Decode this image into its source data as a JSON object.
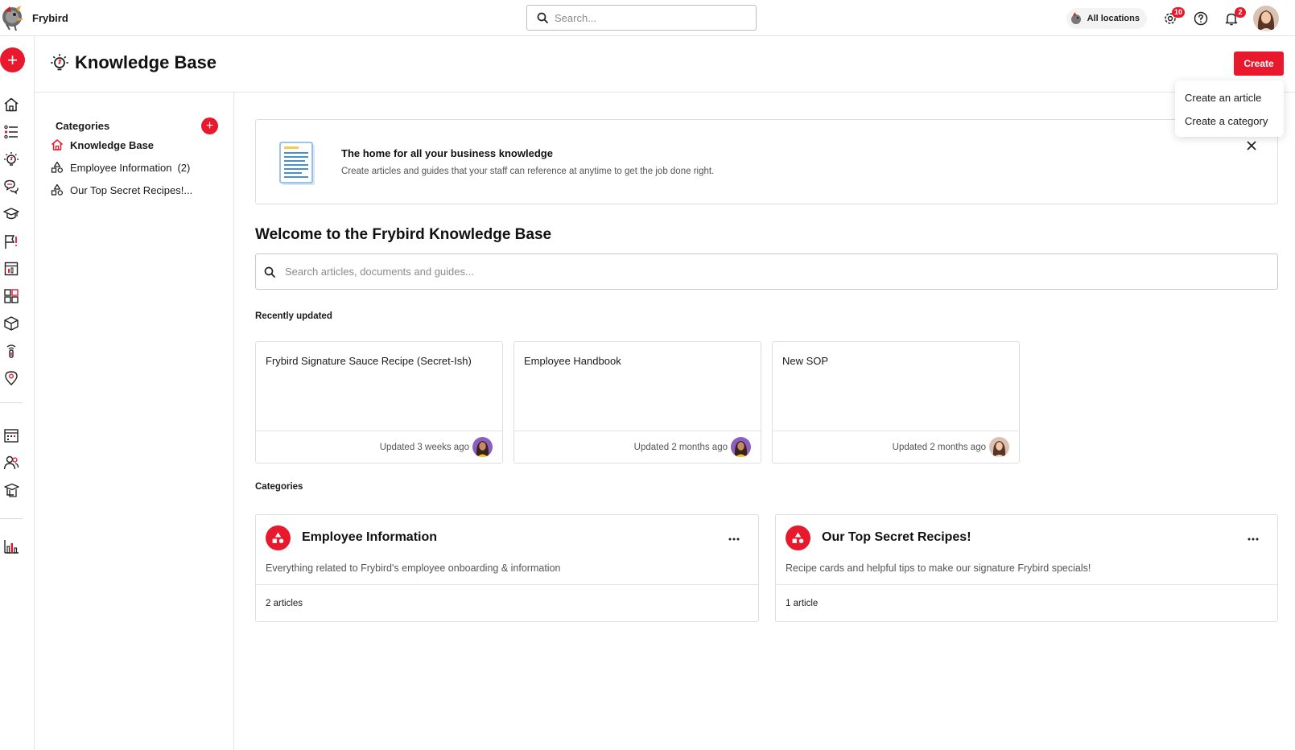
{
  "app": {
    "name": "Frybird",
    "search_placeholder": "Search...",
    "location_label": "All locations",
    "tasks_badge": "10",
    "notifications_badge": "2"
  },
  "rail": {
    "icons": [
      "home-icon",
      "checklist-icon",
      "lightbulb-icon",
      "chat-icon",
      "graduation-cap-icon",
      "flag-icon",
      "store-icon",
      "dashboard-icon",
      "box-icon",
      "thermometer-icon",
      "location-pin-icon",
      "calendar-icon",
      "team-icon",
      "training-icon",
      "bar-chart-icon"
    ]
  },
  "header": {
    "title": "Knowledge Base",
    "create_label": "Create"
  },
  "create_menu": {
    "items": [
      {
        "label": "Create an article"
      },
      {
        "label": "Create a category"
      }
    ]
  },
  "sidebar": {
    "title": "Categories",
    "items": [
      {
        "label": "Knowledge Base",
        "icon": "home-icon"
      },
      {
        "label": "Employee Information",
        "count": "(2)",
        "icon": "shapes-icon"
      },
      {
        "label": "Our Top Secret Recipes!...",
        "icon": "shapes-icon"
      }
    ]
  },
  "banner": {
    "title": "The home for all your business knowledge",
    "subtitle": "Create articles and guides that your staff can reference at anytime to get the job done right."
  },
  "welcome_title": "Welcome to the Frybird Knowledge Base",
  "kb_search_placeholder": "Search articles, documents and guides...",
  "recently_updated": {
    "label": "Recently updated",
    "articles": [
      {
        "title": "Frybird Signature Sauce Recipe (Secret-Ish)",
        "updated": "Updated 3 weeks ago"
      },
      {
        "title": "Employee Handbook",
        "updated": "Updated 2 months ago"
      },
      {
        "title": "New SOP",
        "updated": "Updated 2 months ago"
      }
    ]
  },
  "categories": {
    "label": "Categories",
    "cards": [
      {
        "title": "Employee Information",
        "description": "Everything related to Frybird's employee onboarding & information",
        "count": "2 articles"
      },
      {
        "title": "Our Top Secret Recipes!",
        "description": "Recipe cards and helpful tips to make our signature Frybird specials!",
        "count": "1 article"
      }
    ]
  },
  "colors": {
    "accent": "#e8192c",
    "border": "#dedede"
  }
}
